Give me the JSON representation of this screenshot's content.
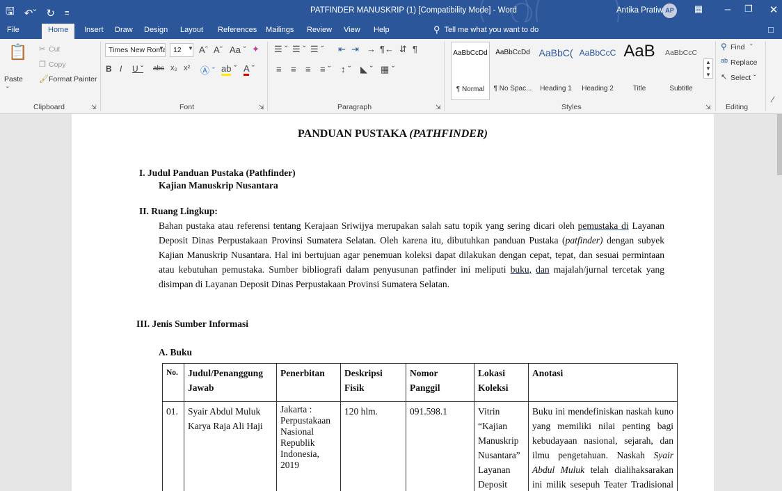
{
  "titlebar": {
    "doc_title": "PATFINDER MANUSKRIP (1) [Compatibility Mode] - Word",
    "user_name": "Antika Pratiwi",
    "user_initials": "AP",
    "accent": "#2b579a"
  },
  "tabs": [
    "File",
    "Home",
    "Insert",
    "Draw",
    "Design",
    "Layout",
    "References",
    "Mailings",
    "Review",
    "View",
    "Help"
  ],
  "tell_me": "Tell me what you want to do",
  "clipboard": {
    "paste": "Paste",
    "cut": "Cut",
    "copy": "Copy",
    "format_painter": "Format Painter",
    "label": "Clipboard"
  },
  "font": {
    "name": "Times New Roma",
    "size": "12",
    "label": "Font"
  },
  "paragraph": {
    "label": "Paragraph"
  },
  "styles": {
    "label": "Styles",
    "items": [
      {
        "sample": "AaBbCcDd",
        "name": "¶ Normal"
      },
      {
        "sample": "AaBbCcDd",
        "name": "¶ No Spac..."
      },
      {
        "sample": "AaBbC(",
        "name": "Heading 1"
      },
      {
        "sample": "AaBbCcC",
        "name": "Heading 2"
      },
      {
        "sample": "AaB",
        "name": "Title"
      },
      {
        "sample": "AaBbCcC",
        "name": "Subtitle"
      }
    ]
  },
  "editing": {
    "find": "Find",
    "replace": "Replace",
    "select": "Select",
    "label": "Editing"
  },
  "document": {
    "title_main": "PANDUAN PUSTAKA ",
    "title_italic": "(PATHFINDER)",
    "section1_heading": "I. Judul Panduan Pustaka (Pathfinder)",
    "section1_sub": "Kajian Manuskrip Nusantara",
    "section2_heading": "II. Ruang Lingkup:",
    "para_parts": {
      "p1": "Bahan pustaka atau referensi tentang Kerajaan Sriwijya merupakan salah satu topik yang sering dicari oleh ",
      "p2": "pemustaka di",
      "p3": " Layanan Deposit Dinas Perpustakaan Provinsi Sumatera Selatan. Oleh karena itu, dibutuhkan panduan Pustaka (",
      "p4": "patfinder)",
      "p5": " dengan subyek Kajian Manuskrip Nusantara. Hal ini bertujuan agar penemuan koleksi dapat dilakukan dengan cepat, tepat, dan sesuai permintaan atau kebutuhan pemustaka. Sumber bibliografi dalam penyusunan patfinder ini meliputi ",
      "p6": "buku,",
      "p7": "  ",
      "p8": "dan",
      "p9": " majalah/jurnal tercetak yang disimpan di Layanan Deposit Dinas Perpustakaan Provinsi Sumatera Selatan."
    },
    "section3_heading": "III. Jenis Sumber Informasi",
    "subsection_a": "A. Buku",
    "table": {
      "headers": [
        "No.",
        "Judul/Penanggung Jawab",
        "Penerbitan",
        "Deskripsi Fisik",
        "Nomor Panggil",
        "Lokasi Koleksi",
        "Anotasi"
      ],
      "row1": {
        "no": "01.",
        "judul": "Syair Abdul Muluk Karya Raja Ali Haji",
        "penerbitan": "Jakarta : Perpustakaan Nasional Republik Indonesia, 2019",
        "deskripsi": "120 hlm.",
        "nomor": "091.598.1",
        "lokasi": "Vitrin “Kajian Manuskrip Nusantara” Layanan Deposit",
        "anot1": "Buku ini mendefiniskan naskah kuno yang memiliki nilai penting bagi kebudayaan nasional, sejarah, dan ilmu pengetahuan. Naskah ",
        "anot_italic": "Syair Abdul Muluk",
        "anot2": " telah dialihaksarakan ini milik sesepuh Teater Tradisional Dul"
      }
    }
  }
}
